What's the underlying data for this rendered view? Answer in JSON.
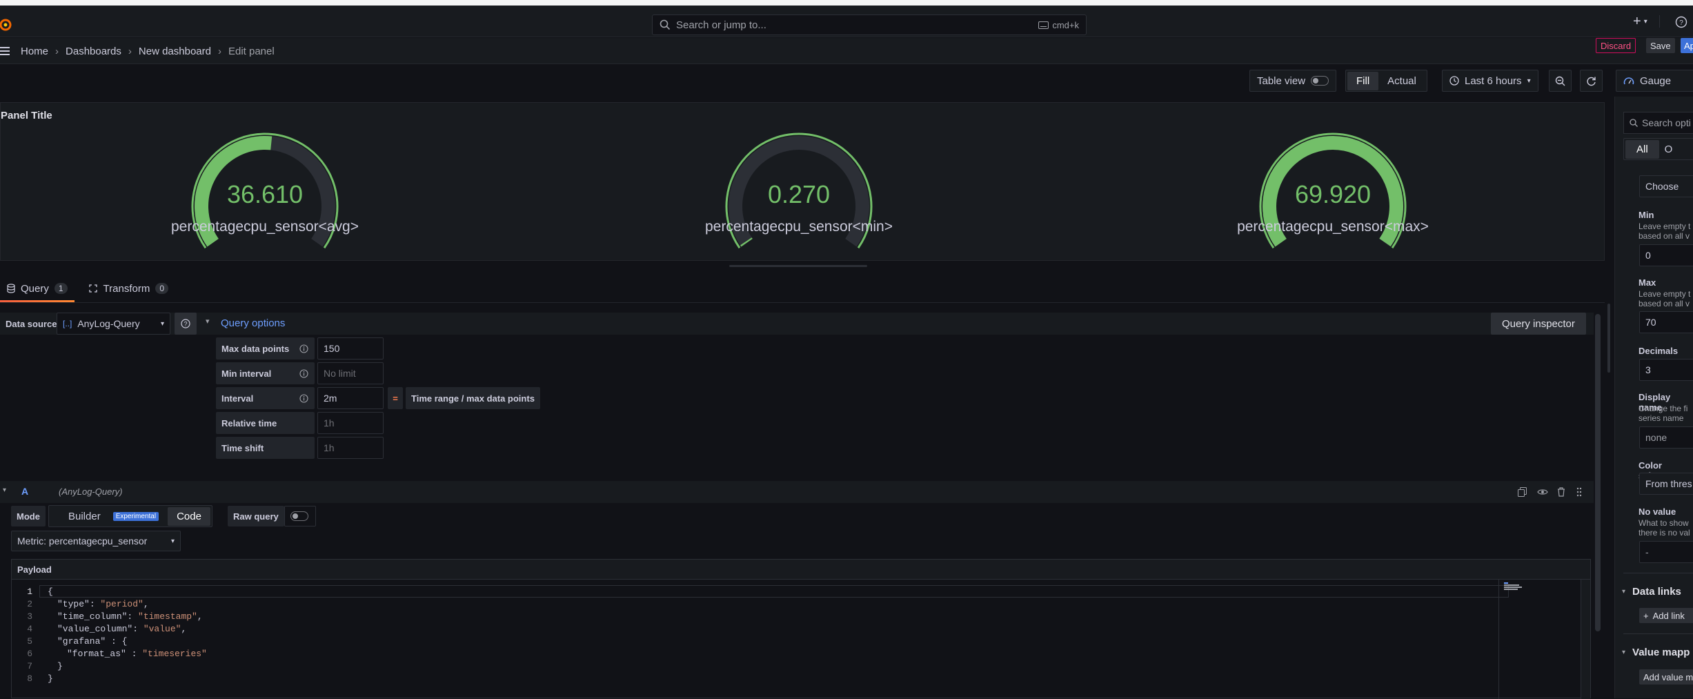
{
  "topbar": {
    "search_placeholder": "Search or jump to...",
    "search_shortcut": "cmd+k",
    "plus_label": "+"
  },
  "breadcrumb": [
    "Home",
    "Dashboards",
    "New dashboard",
    "Edit panel"
  ],
  "actions": {
    "discard": "Discard",
    "save": "Save",
    "apply": "Ap"
  },
  "toolbar": {
    "table_view": "Table view",
    "fill": "Fill",
    "actual": "Actual",
    "time_range": "Last 6 hours",
    "visualization": "Gauge"
  },
  "panel": {
    "title": "Panel Title",
    "gauges": [
      {
        "value": "36.610",
        "name": "percentagecpu_sensor<avg>",
        "fraction": 0.523
      },
      {
        "value": "0.270",
        "name": "percentagecpu_sensor<min>",
        "fraction": 0.004
      },
      {
        "value": "69.920",
        "name": "percentagecpu_sensor<max>",
        "fraction": 0.999
      }
    ],
    "gauge_color": "#73bf69",
    "track_color": "#2c2f36"
  },
  "tabs": [
    {
      "label": "Query",
      "count": "1"
    },
    {
      "label": "Transform",
      "count": "0"
    }
  ],
  "query": {
    "data_source_label": "Data source",
    "data_source": "AnyLog-Query",
    "query_options": "Query options",
    "query_inspector": "Query inspector",
    "options": [
      {
        "label": "Max data points",
        "value": "150",
        "placeholder": false
      },
      {
        "label": "Min interval",
        "value": "No limit",
        "placeholder": true
      },
      {
        "label": "Interval",
        "value": "2m",
        "placeholder": false
      },
      {
        "label": "Relative time",
        "value": "1h",
        "placeholder": true
      },
      {
        "label": "Time shift",
        "value": "1h",
        "placeholder": true
      }
    ],
    "interval_eq": "=",
    "interval_formula": "Time range / max data points"
  },
  "query_a": {
    "ref": "A",
    "ds": "(AnyLog-Query)",
    "mode_label": "Mode",
    "builder": "Builder",
    "experimental": "Experimental",
    "code": "Code",
    "raw_query": "Raw query",
    "metric": "Metric: percentagecpu_sensor",
    "payload": "Payload"
  },
  "code_lines": [
    {
      "n": "1",
      "text": "{"
    },
    {
      "n": "2",
      "key": "\"type\"",
      "val": "\"period\"",
      "tail": ","
    },
    {
      "n": "3",
      "key": "\"time_column\"",
      "val": "\"timestamp\"",
      "tail": ","
    },
    {
      "n": "4",
      "key": "\"value_column\"",
      "val": "\"value\"",
      "tail": ","
    },
    {
      "n": "5",
      "key": "\"grafana\"",
      "sepx": " : ",
      "val": "",
      "tail": "{"
    },
    {
      "n": "6",
      "key": "\"format_as\"",
      "sepx": " : ",
      "val": "\"timeseries\"",
      "tail": ""
    },
    {
      "n": "7",
      "text": "}"
    },
    {
      "n": "8",
      "text": "}"
    }
  ],
  "options_pane": {
    "search": "Search opti",
    "all": "All",
    "other": "O",
    "choose": "Choose",
    "min_label": "Min",
    "min_desc1": "Leave empty t",
    "min_desc2": "based on all v",
    "min_value": "0",
    "max_label": "Max",
    "max_desc1": "Leave empty t",
    "max_desc2": "based on all v",
    "max_value": "70",
    "decimals_label": "Decimals",
    "decimals_value": "3",
    "display_name_label": "Display name",
    "display_name_desc1": "Change the fi",
    "display_name_desc2": "series name",
    "display_name_value": "none",
    "color_scheme_label": "Color scheme",
    "color_scheme_value": "From thres",
    "no_value_label": "No value",
    "no_value_desc1": "What to show",
    "no_value_desc2": "there is no val",
    "no_value_value": "-",
    "data_links": "Data links",
    "add_link": "Add link",
    "value_mappings": "Value mapp",
    "add_value_mapping": "Add value m"
  }
}
